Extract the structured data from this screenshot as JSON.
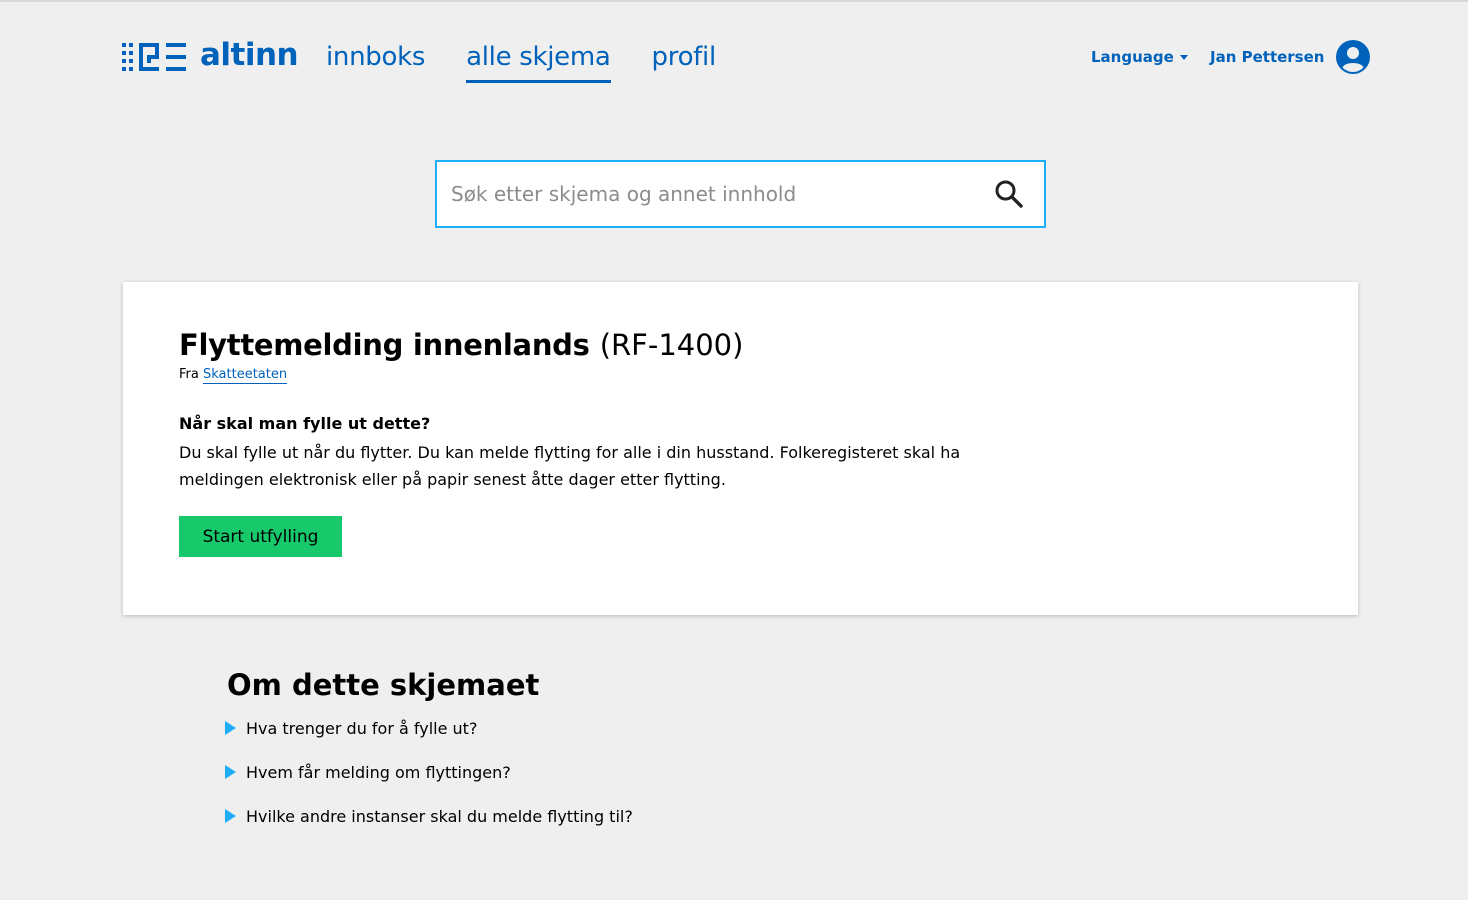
{
  "header": {
    "logo_text": "altinn",
    "nav": [
      {
        "label": "innboks",
        "active": false
      },
      {
        "label": "alle skjema",
        "active": true
      },
      {
        "label": "profil",
        "active": false
      }
    ],
    "language_label": "Language",
    "user_name": "Jan Pettersen"
  },
  "search": {
    "placeholder": "Søk etter skjema og annet innhold",
    "value": ""
  },
  "card": {
    "title": "Flyttemelding innenlands",
    "code": "(RF-1400)",
    "from_prefix": "Fra",
    "from_link": "Skatteetaten",
    "question": "Når skal man fylle ut dette?",
    "description": "Du skal fylle ut når du flytter. Du kan melde flytting for alle i din husstand. Folkeregisteret skal ha meldingen elektronisk eller på papir senest åtte dager etter flytting.",
    "start_button": "Start utfylling"
  },
  "about": {
    "title": "Om dette skjemaet",
    "items": [
      "Hva trenger du for å fylle ut?",
      "Hvem får melding om flyttingen?",
      "Hvilke andre instanser skal du melde flytting til?"
    ]
  },
  "colors": {
    "brand_blue": "#0062ba",
    "accent_blue": "#1eaef7",
    "start_green": "#17c96b",
    "page_bg": "#efefef"
  },
  "icons": [
    "altinn-logo-icon",
    "caret-down-icon",
    "user-avatar-icon",
    "search-icon",
    "triangle-right-icon"
  ]
}
